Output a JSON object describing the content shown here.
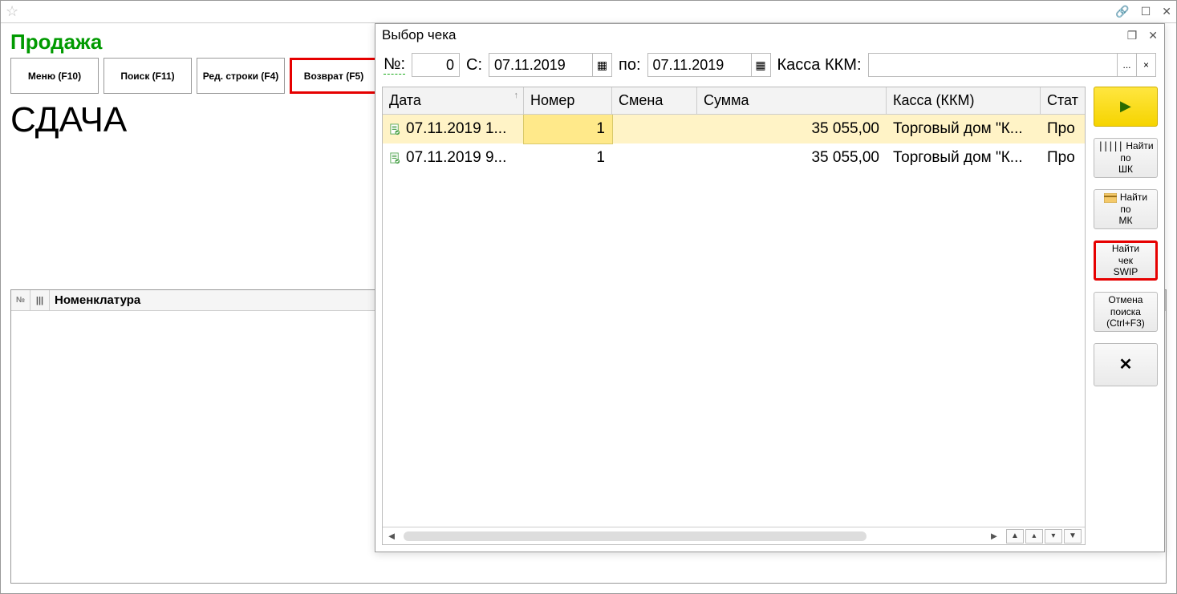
{
  "main": {
    "sale_title": "Продажа",
    "toolbar": {
      "menu": "Меню (F10)",
      "search": "Поиск (F11)",
      "edit_rows": "Ред. строки (F4)",
      "return": "Возврат (F5)"
    },
    "sdacha": "СДАЧА",
    "grid_header_number_symbol": "№",
    "grid_header_barcode_symbol": "|||",
    "grid_header_nomenklatura": "Номенклатура"
  },
  "dialog": {
    "title": "Выбор чека",
    "filters": {
      "number_label": "№:",
      "number_value": "0",
      "from_label": "С:",
      "from_date": "07.11.2019",
      "to_label": "по:",
      "to_date": "07.11.2019",
      "kassa_label": "Касса ККМ:",
      "kassa_value": "",
      "ellipsis": "...",
      "clear": "×"
    },
    "columns": {
      "date": "Дата",
      "number": "Номер",
      "smena": "Смена",
      "summa": "Сумма",
      "kkm": "Касса (ККМ)",
      "status": "Стат"
    },
    "rows": [
      {
        "date": "07.11.2019 1...",
        "number": "1",
        "smena": "",
        "summa": "35 055,00",
        "kkm": "Торговый дом \"К...",
        "status": "Про"
      },
      {
        "date": "07.11.2019 9...",
        "number": "1",
        "smena": "",
        "summa": "35 055,00",
        "kkm": "Торговый дом \"К...",
        "status": "Про"
      }
    ],
    "side": {
      "play": "▶",
      "find_by_barcode": "Найти по ШК",
      "find_by_mk": "Найти по МК",
      "find_swip": "Найти чек SWIP",
      "cancel_search": "Отмена поиска (Ctrl+F3)",
      "close": "✕"
    }
  },
  "window_icons": {
    "link": "🔗",
    "maximize": "☐",
    "close": "✕",
    "star": "☆",
    "calendar": "▦",
    "dlg_restore": "❐"
  }
}
